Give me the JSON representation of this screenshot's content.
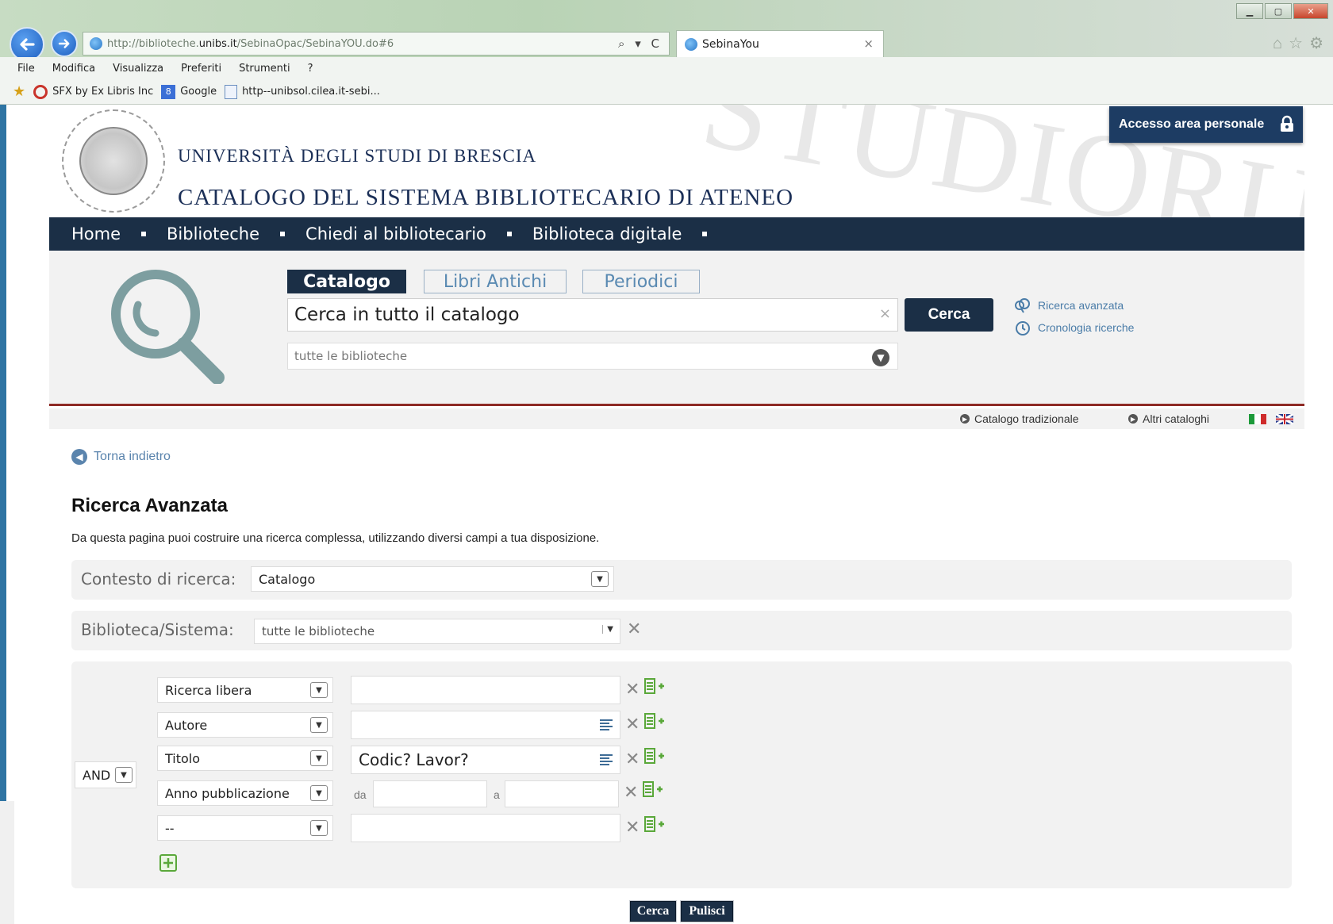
{
  "browser": {
    "url_prefix": "http://biblioteche.",
    "url_domain": "unibs.it",
    "url_path": "/SebinaOpac/SebinaYOU.do#6",
    "url_tools": "⌕ ▾ C",
    "tab_title": "SebinaYou",
    "tab_close": "×",
    "menu": [
      "File",
      "Modifica",
      "Visualizza",
      "Preferiti",
      "Strumenti",
      "?"
    ],
    "favorites": [
      "SFX by Ex Libris Inc",
      "Google",
      "http--unibsol.cilea.it-sebi..."
    ],
    "google_glyph": "8"
  },
  "header": {
    "university": "UNIVERSITÀ DEGLI STUDI DI BRESCIA",
    "catalog": "CATALOGO DEL SISTEMA BIBLIOTECARIO DI ATENEO",
    "login_label": "Accesso area personale"
  },
  "topnav": [
    "Home",
    "Biblioteche",
    "Chiedi al bibliotecario",
    "Biblioteca digitale"
  ],
  "search": {
    "tabs": [
      "Catalogo",
      "Libri Antichi",
      "Periodici"
    ],
    "query": "Cerca in tutto il catalogo",
    "clear_glyph": "×",
    "button": "Cerca",
    "library_select": "tutte le biblioteche",
    "links": [
      "Ricerca avanzata",
      "Cronologia ricerche"
    ]
  },
  "subbar": {
    "links": [
      "Catalogo tradizionale",
      "Altri cataloghi"
    ]
  },
  "content": {
    "back": "Torna indietro",
    "title": "Ricerca Avanzata",
    "description": "Da questa pagina puoi costruire una ricerca complessa, utilizzando diversi campi a tua disposizione.",
    "context_label": "Contesto di ricerca:",
    "context_value": "Catalogo",
    "library_label": "Biblioteca/Sistema:",
    "library_value": "tutte le biblioteche",
    "operator": "AND",
    "criteria": [
      {
        "field": "Ricerca libera",
        "value": ""
      },
      {
        "field": "Autore",
        "value": ""
      },
      {
        "field": "Titolo",
        "value": "Codic? Lavor?"
      },
      {
        "field": "Anno pubblicazione",
        "from_label": "da",
        "to_label": "a",
        "from": "",
        "to": ""
      },
      {
        "field": "--",
        "value": ""
      }
    ],
    "buttons": {
      "search": "Cerca",
      "clear": "Pulisci"
    }
  },
  "glyphs": {
    "remove": "✕",
    "chevron": "⌄"
  },
  "colors": {
    "nav_bg": "#1b2f46",
    "link": "#4a7ca8",
    "accent_red": "#8e2a25",
    "add_green": "#5aa83a"
  },
  "icons": [
    "back-arrow-icon",
    "forward-arrow-icon",
    "globe-icon",
    "magnifier-icon",
    "lock-icon",
    "clock-icon",
    "list-icon",
    "remove-icon",
    "add-row-icon",
    "flag-it-icon",
    "flag-uk-icon"
  ]
}
